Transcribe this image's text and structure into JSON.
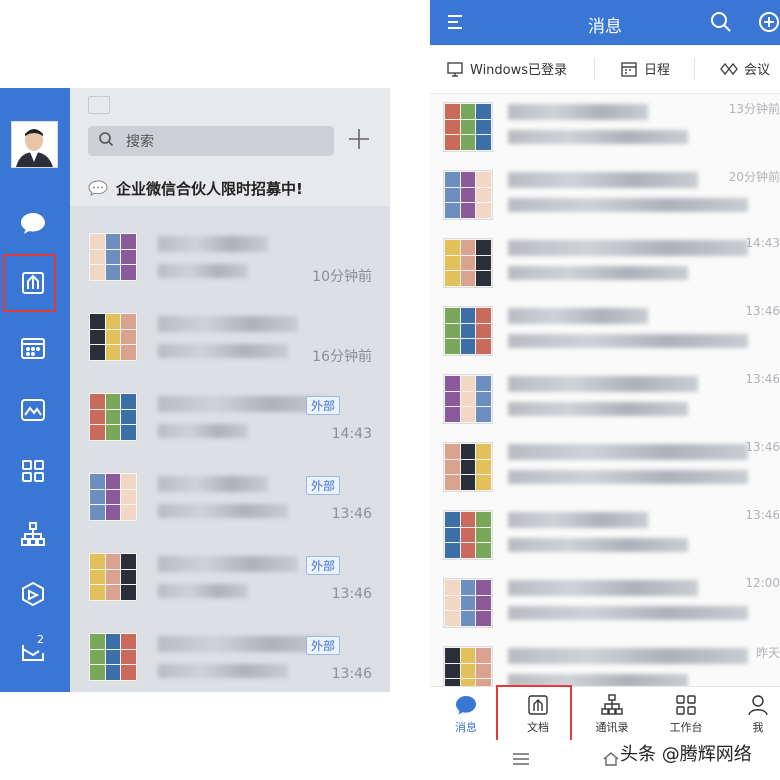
{
  "desktop": {
    "search": {
      "placeholder": "搜索"
    },
    "banner": {
      "text": "企业微信合伙人限时招募中!"
    },
    "rail_badge": "2",
    "rows": [
      {
        "time": "10分钟前",
        "tag": ""
      },
      {
        "time": "16分钟前",
        "tag": ""
      },
      {
        "time": "14:43",
        "tag": "外部"
      },
      {
        "time": "13:46",
        "tag": "外部"
      },
      {
        "time": "13:46",
        "tag": "外部"
      },
      {
        "time": "13:46",
        "tag": "外部"
      }
    ]
  },
  "mobile": {
    "title": "消息",
    "quickbar": [
      {
        "label": "Windows已登录",
        "icon": "monitor-icon"
      },
      {
        "label": "日程",
        "icon": "calendar-icon"
      },
      {
        "label": "会议",
        "icon": "meeting-icon"
      }
    ],
    "rows": [
      {
        "time": "13分钟前"
      },
      {
        "time": "20分钟前"
      },
      {
        "time": "14:43"
      },
      {
        "time": "13:46"
      },
      {
        "time": "13:46"
      },
      {
        "time": "13:46"
      },
      {
        "time": "13:46"
      },
      {
        "time": "12:00"
      },
      {
        "time": "昨天"
      }
    ],
    "tabs": [
      {
        "label": "消息",
        "icon": "message-icon"
      },
      {
        "label": "文档",
        "icon": "docs-icon"
      },
      {
        "label": "通讯录",
        "icon": "contacts-icon"
      },
      {
        "label": "工作台",
        "icon": "workbench-icon"
      },
      {
        "label": "我",
        "icon": "me-icon"
      }
    ]
  },
  "watermark": "头条 @腾辉网络",
  "colors": {
    "accent": "#3a76d4",
    "highlight": "#e03b3b"
  }
}
